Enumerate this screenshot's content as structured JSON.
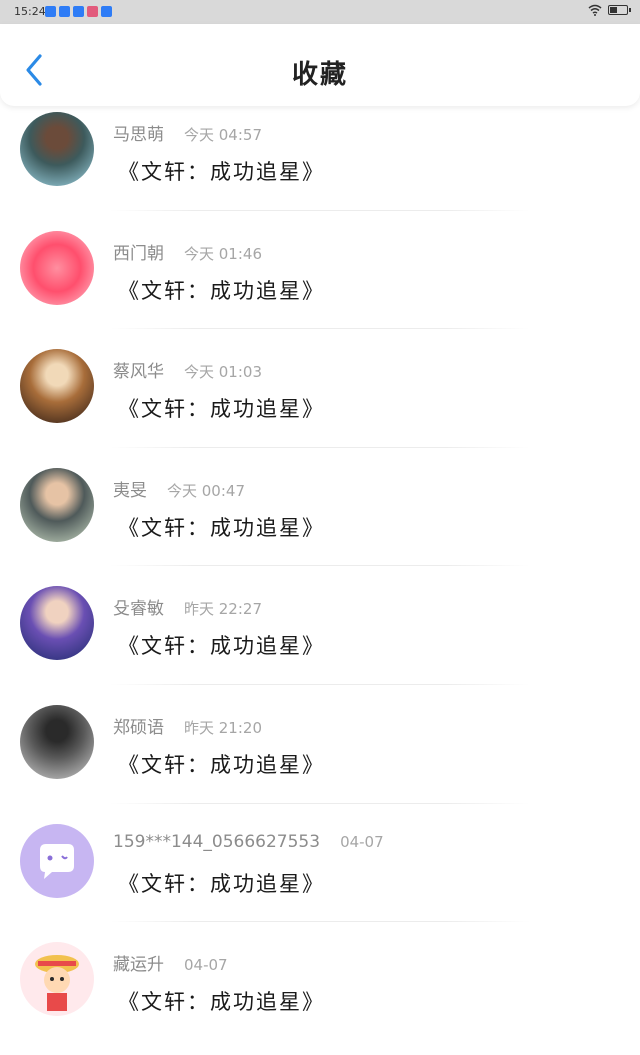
{
  "status_bar": {
    "time": "15:24",
    "notification_colors": [
      "#2e7cf6",
      "#2e7cf6",
      "#2e7cf6",
      "#e25b7c",
      "#2e7cf6"
    ]
  },
  "header": {
    "title": "收藏",
    "back_icon": "chevron-left-icon",
    "accent_color": "#2b8ae6"
  },
  "items": [
    {
      "user": "马思萌",
      "time": "今天 04:57",
      "title": "《文轩：成功追星》",
      "avatar_colors": [
        "#9fd6e6",
        "#3d5a5c",
        "#6b4b3a"
      ]
    },
    {
      "user": "西门朝",
      "time": "今天 01:46",
      "title": "《文轩：成功追星》",
      "avatar_colors": [
        "#ff4f6d",
        "#ff8fa0",
        "#ffc4cf"
      ]
    },
    {
      "user": "蔡风华",
      "time": "今天 01:03",
      "title": "《文轩：成功追星》",
      "avatar_colors": [
        "#2a1a14",
        "#a86d3a",
        "#f1d9b8"
      ]
    },
    {
      "user": "夷旻",
      "time": "今天 00:47",
      "title": "《文轩：成功追星》",
      "avatar_colors": [
        "#c9d8c2",
        "#4f5a5a",
        "#e6c3a5"
      ]
    },
    {
      "user": "殳睿敏",
      "time": "昨天 22:27",
      "title": "《文轩：成功追星》",
      "avatar_colors": [
        "#1c2a6b",
        "#6a4fb3",
        "#f0d2c0"
      ]
    },
    {
      "user": "郑硕语",
      "time": "昨天 21:20",
      "title": "《文轩：成功追星》",
      "avatar_colors": [
        "#d0d0d0",
        "#5a5a5a",
        "#2a2a2a"
      ]
    },
    {
      "user": "159***144_0566627553",
      "time": "04-07",
      "title": "《文轩：成功追星》",
      "avatar_colors": [
        "#c7b6f2",
        "#ffffff",
        "#8a6fd8"
      ]
    },
    {
      "user": "藏运升",
      "time": "04-07",
      "title": "《文轩：成功追星》",
      "avatar_colors": [
        "#ffe9ec",
        "#e84a4a",
        "#2a2a2a"
      ]
    }
  ]
}
